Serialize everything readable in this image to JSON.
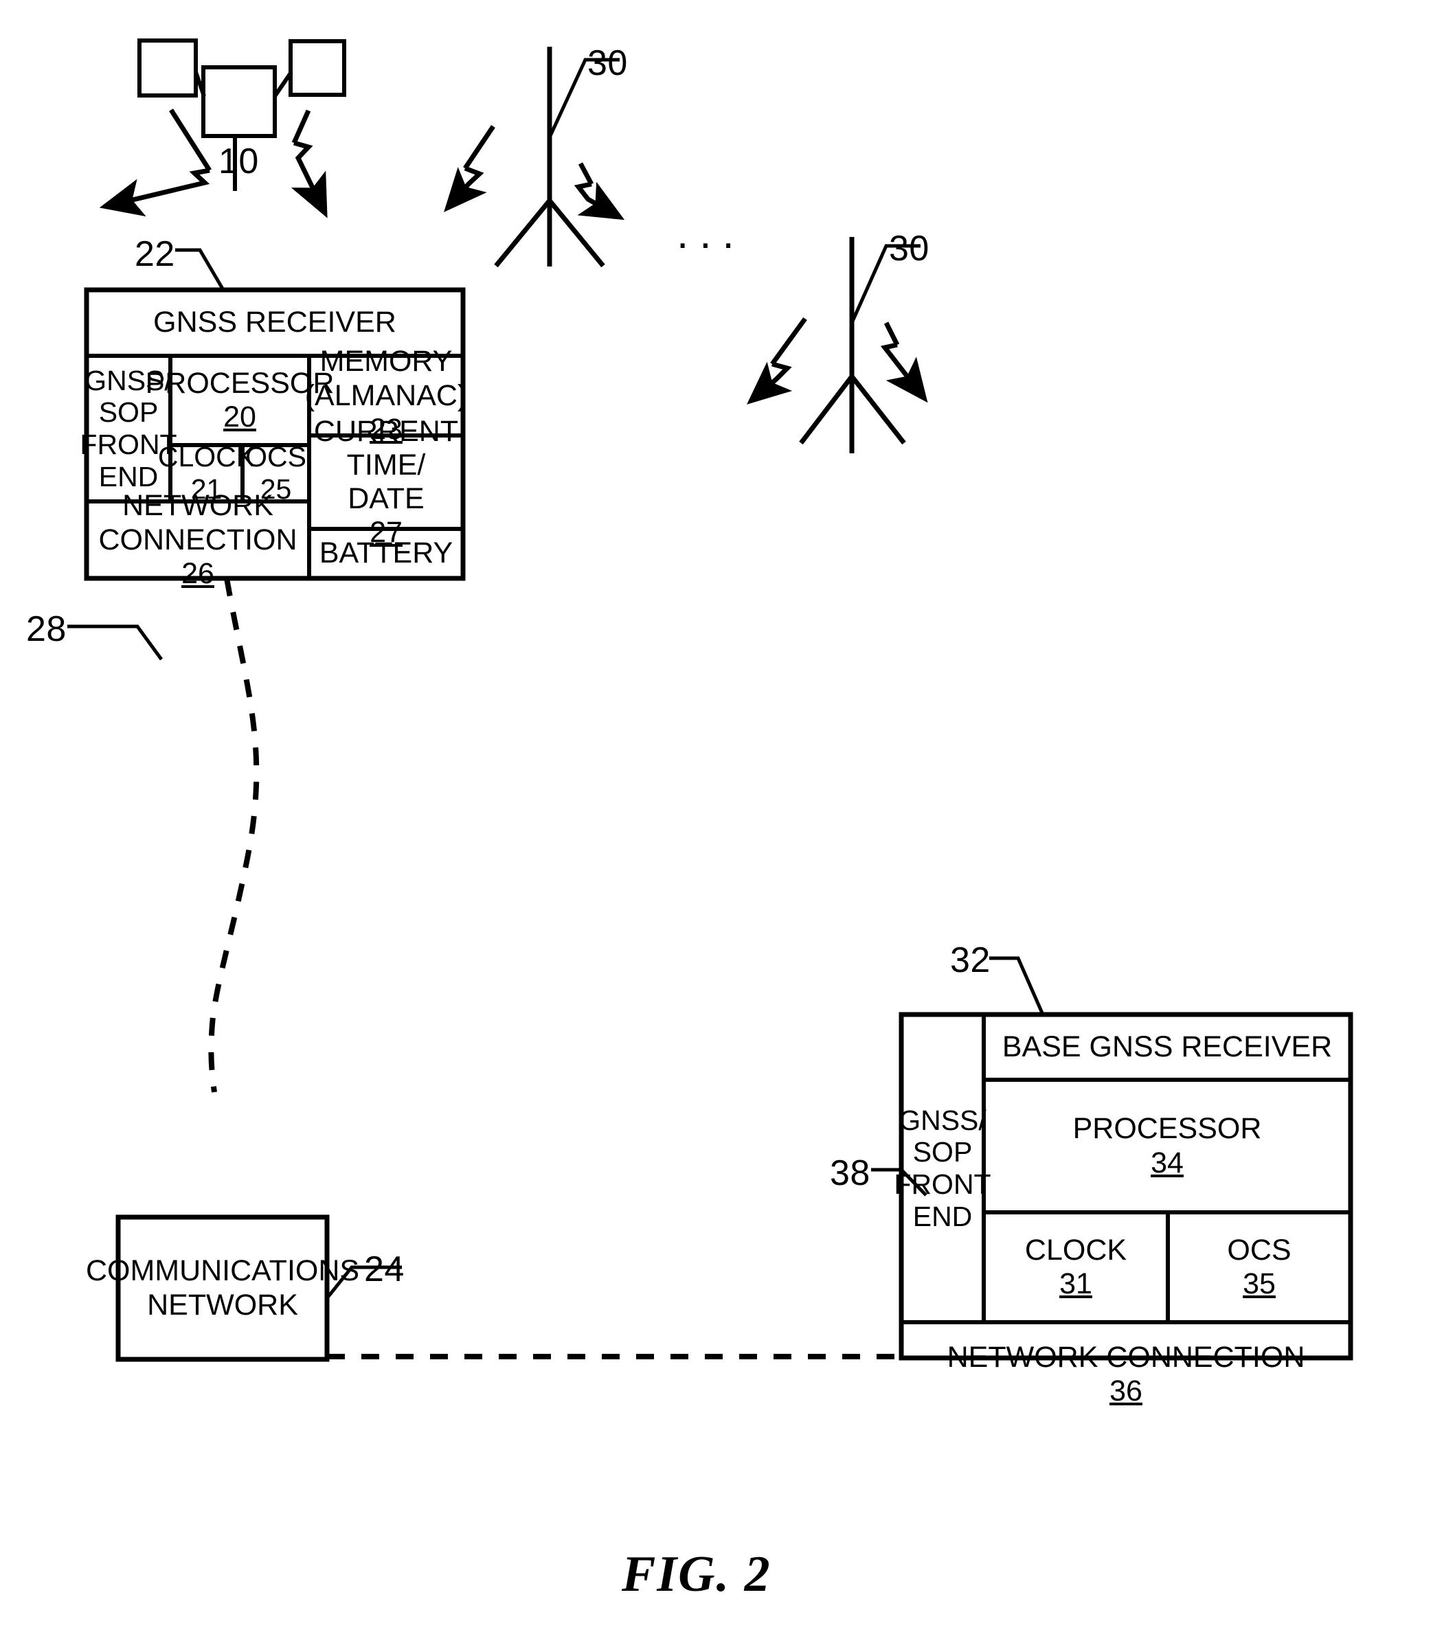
{
  "figure": {
    "caption": "FIG. 2",
    "ellipsis": "..."
  },
  "reference_numerals": {
    "rover_cluster": "10",
    "gnss_receiver": "22",
    "gnss_sop_front_end_rover": "28",
    "comm_network": "24",
    "sop_tower": "30",
    "sop_tower_2": "30",
    "base_gnss_receiver": "32",
    "gnss_sop_front_end_base": "38"
  },
  "gnss_receiver": {
    "title": "GNSS RECEIVER",
    "front_end": "GNSS/\nSOP\nFRONT\nEND",
    "processor": {
      "label": "PROCESSOR",
      "num": "20"
    },
    "memory": {
      "label": "MEMORY\n(ALMANAC)",
      "num": "23"
    },
    "clock": {
      "label": "CLOCK",
      "num": "21"
    },
    "ocs": {
      "label": "OCS",
      "num": "25"
    },
    "current_time": {
      "label": "CURRENT TIME/\nDATE",
      "num": "27"
    },
    "network_connection": {
      "label": "NETWORK\nCONNECTION",
      "num": "26"
    },
    "battery": {
      "label": "BATTERY",
      "num": ""
    }
  },
  "comm_network": {
    "label": "COMMUNICATIONS\nNETWORK"
  },
  "base_receiver": {
    "title": "BASE GNSS RECEIVER",
    "front_end": "GNSS/\nSOP\nFRONT\nEND",
    "processor": {
      "label": "PROCESSOR",
      "num": "34"
    },
    "clock": {
      "label": "CLOCK",
      "num": "31"
    },
    "ocs": {
      "label": "OCS",
      "num": "35"
    },
    "network_connection": {
      "label": "NETWORK CONNECTION",
      "num": "36"
    }
  },
  "colors": {
    "ink": "#000000",
    "paper": "#ffffff"
  }
}
